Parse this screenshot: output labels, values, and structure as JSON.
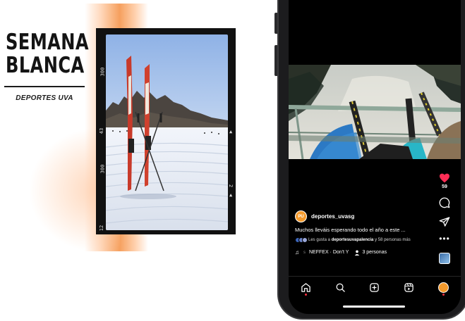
{
  "poster": {
    "title_line1": "SEMANA",
    "title_line2": "BLANCA",
    "subtitle": "DEPORTES UVA",
    "film_marks": [
      "300",
      "43",
      "300",
      "12",
      "2"
    ]
  },
  "reel": {
    "likes_count": "59",
    "username": "deportes_uvasg",
    "avatar_text": "PU",
    "caption": "Muchos lleváis esperando todo el año a este ...",
    "likes_prefix": "Les gusta a ",
    "likes_user": "deportesuvapalencia",
    "likes_suffix": " y 58 personas más",
    "music_fade": "s",
    "music_track": "NEFFEX · Don't Y",
    "people_count": "3 personas"
  },
  "tabbar": {
    "items": [
      "home-icon",
      "search-icon",
      "create-icon",
      "reels-icon",
      "profile-avatar"
    ]
  },
  "colors": {
    "heart": "#ff2d55",
    "accent_orange": "#f49a2c",
    "screen_bg": "#000000"
  }
}
